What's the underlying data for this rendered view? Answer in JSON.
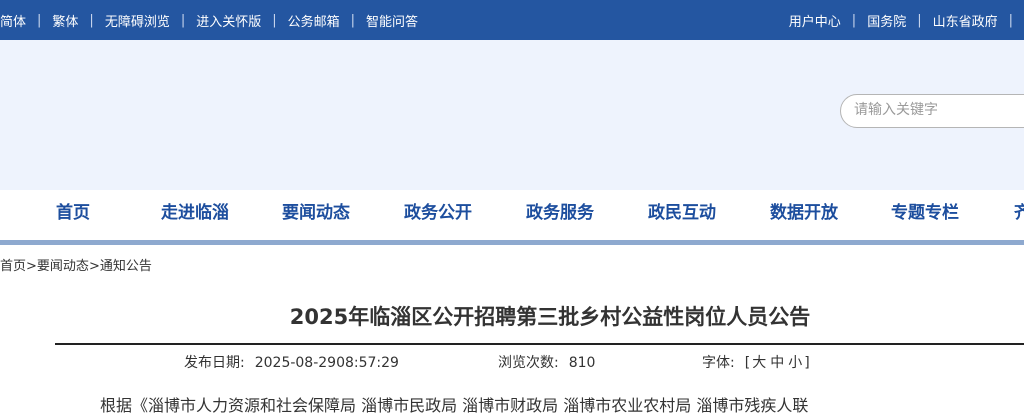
{
  "topbar": {
    "left_links": [
      "简体",
      "繁体",
      "无障碍浏览",
      "进入关怀版",
      "公务邮箱",
      "智能问答"
    ],
    "right_links": [
      "用户中心",
      "国务院",
      "山东省政府"
    ],
    "separator": "|"
  },
  "search": {
    "placeholder": "请输入关键字"
  },
  "nav": {
    "items": [
      "首页",
      "走进临淄",
      "要闻动态",
      "政务公开",
      "政务服务",
      "政民互动",
      "数据开放",
      "专题专栏",
      "齐"
    ]
  },
  "breadcrumb": {
    "items": [
      "首页",
      "要闻动态",
      "通知公告"
    ],
    "separator": ">"
  },
  "article": {
    "title": "2025年临淄区公开招聘第三批乡村公益性岗位人员公告",
    "publish_label": "发布日期:",
    "publish_value": "2025-08-2908:57:29",
    "views_label": "浏览次数:",
    "views_value": "810",
    "font_label": "字体:",
    "font_open": "[",
    "font_options": [
      "大",
      "中",
      "小"
    ],
    "font_close": "]",
    "body_start": "根据《淄博市人力资源和社会保障局 淄博市民政局 淄博市财政局 淄博市农业农村局 淄博市残疾人联"
  },
  "colors": {
    "topbar": "#2456a1",
    "nav_text": "#1d4e9e",
    "banner": "#eef3fd",
    "nav_line": "#8ea9cf"
  }
}
